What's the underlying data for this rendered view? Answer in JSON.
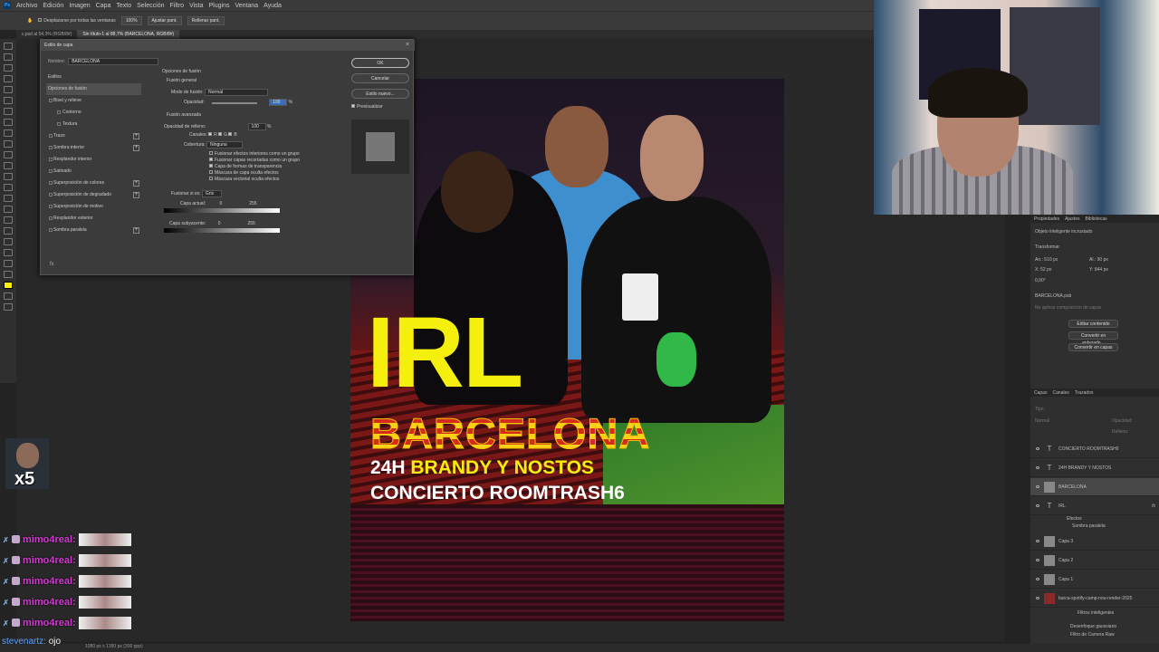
{
  "menu": [
    "Archivo",
    "Edición",
    "Imagen",
    "Capa",
    "Texto",
    "Selección",
    "Filtro",
    "Vista",
    "Plugins",
    "Ventana",
    "Ayuda"
  ],
  "options": {
    "scroll_all": "Desplazarse por todas las ventanas",
    "zoom": "100%",
    "fit": "Ajustar pant.",
    "fill": "Rellenar pant."
  },
  "tabs": [
    "c.psd al 54,3% (RGB/8#)",
    "Sin título-1 al 88,7% (BARCELONA, RGB/8#)"
  ],
  "dialog": {
    "title": "Estilo de capa",
    "name_label": "Nombre:",
    "name_value": "BARCELONA",
    "styles_header": "Estilos",
    "items": [
      {
        "label": "Opciones de fusión",
        "active": true
      },
      {
        "label": "Bisel y relieve",
        "check": true
      },
      {
        "label": "Contorno",
        "check": true,
        "sub": true
      },
      {
        "label": "Textura",
        "check": true,
        "sub": true
      },
      {
        "label": "Trazo",
        "check": true,
        "plus": true
      },
      {
        "label": "Sombra interior",
        "check": true,
        "plus": true
      },
      {
        "label": "Resplandor interior",
        "check": true
      },
      {
        "label": "Satinado",
        "check": true
      },
      {
        "label": "Superposición de colores",
        "check": true,
        "plus": true
      },
      {
        "label": "Superposición de degradado",
        "check": true,
        "plus": true
      },
      {
        "label": "Superposición de motivo",
        "check": true
      },
      {
        "label": "Resplandor exterior",
        "check": true
      },
      {
        "label": "Sombra paralela",
        "check": true,
        "plus": true
      }
    ],
    "fx": "fx",
    "blend_opts": "Opciones de fusión",
    "general": "Fusión general",
    "mode_label": "Modo de fusión:",
    "mode_value": "Normal",
    "opacity_label": "Opacidad:",
    "opacity_value": "100",
    "pct": "%",
    "advanced": "Fusión avanzada",
    "fill_label": "Opacidad de relleno:",
    "fill_value": "100",
    "channels_label": "Canales:",
    "ch_r": "R",
    "ch_g": "G",
    "ch_b": "B",
    "knockout_label": "Cobertura:",
    "knockout_value": "Ninguna",
    "adv_checks": [
      {
        "label": "Fusionar efectos interiores como un grupo",
        "on": false
      },
      {
        "label": "Fusionar capas recortadas como un grupo",
        "on": true
      },
      {
        "label": "Capa de formas de transparencia",
        "on": true
      },
      {
        "label": "Máscara de capa oculta efectos",
        "on": false
      },
      {
        "label": "Máscara vectorial oculta efectos",
        "on": false
      }
    ],
    "blendif_label": "Fusionar si es:",
    "blendif_value": "Gris",
    "this_layer": "Capa actual:",
    "this_lo": "0",
    "this_hi": "255",
    "under_layer": "Capa subyacente:",
    "under_lo": "0",
    "under_hi": "255",
    "ok": "OK",
    "cancel": "Cancelar",
    "new_style": "Estilo nuevo...",
    "preview": "Previsualizar"
  },
  "poster": {
    "irl": "IRL",
    "city": "BARCELONA",
    "line1_a": "24H",
    "line1_b": "BRANDY Y NOSTOS",
    "line2": "CONCIERTO ROOMTRASH6"
  },
  "props": {
    "tabs": [
      "Propiedades",
      "Ajustes",
      "Bibliotecas"
    ],
    "obj": "Objeto inteligente incrustado",
    "transform": "Transformar",
    "an": "An.:",
    "an_v": "510 px",
    "al": "Al.:",
    "al_v": "90 px",
    "x": "X:",
    "x_v": "52 px",
    "y": "Y:",
    "y_v": "844 px",
    "ang": "0,00°",
    "file": "BARCELONA.psb",
    "no_comp": "No aplicar composición de capas",
    "edit": "Editar contenido",
    "linked": "Convertir en enlazado...",
    "to_layers": "Convertir en capas"
  },
  "layers": {
    "tabs": [
      "Capas",
      "Canales",
      "Trazados"
    ],
    "search": "Tipo",
    "mode": "Normal",
    "opacity": "Opacidad:",
    "fill": "Relleno:",
    "items": [
      {
        "name": "CONCIERTO ROOMTRASH6",
        "kind": "T"
      },
      {
        "name": "24H BRANDY Y NOSTOS",
        "kind": "T"
      },
      {
        "name": "BARCELONA",
        "kind": "img",
        "active": true
      },
      {
        "name": "IRL",
        "kind": "T",
        "fx": "fx"
      },
      {
        "name": "Capa 3",
        "kind": "img"
      },
      {
        "name": "Capa 2",
        "kind": "img"
      },
      {
        "name": "Capa 1",
        "kind": "img"
      },
      {
        "name": "barca-spotify-camp-nou-render-2025",
        "kind": "img"
      }
    ],
    "effects": "Efectos",
    "drop_shadow": "Sombra paralela",
    "smart_filters": "Filtros inteligentes",
    "blur": "Desenfoque gaussiano",
    "camera_raw": "Filtro de Camera Raw"
  },
  "chat": {
    "messages": [
      {
        "user": "mimo4real:"
      },
      {
        "user": "mimo4real:"
      },
      {
        "user": "mimo4real:"
      },
      {
        "user": "mimo4real:"
      },
      {
        "user": "mimo4real:"
      }
    ],
    "last_user": "stevenartz:",
    "last_text": "ojo",
    "emote_count": "x5"
  },
  "status": "1080 px x 1350 px (300 ppp)"
}
